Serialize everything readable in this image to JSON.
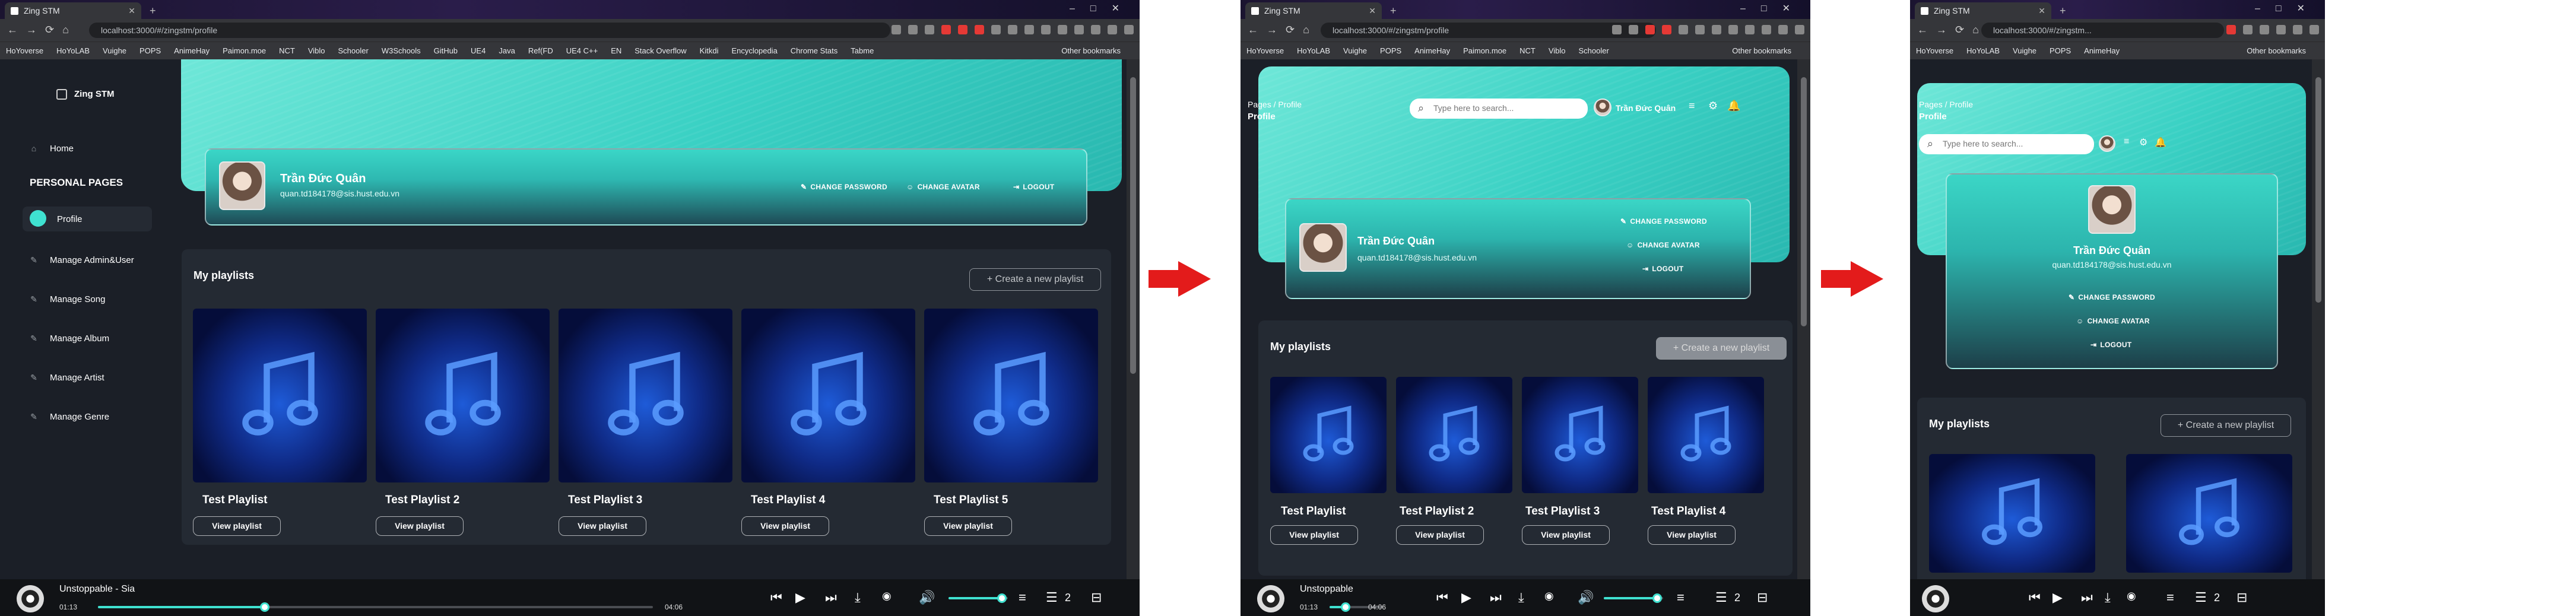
{
  "browser": {
    "tab_title": "Zing STM",
    "url_full": "localhost:3000/#/zingstm/profile",
    "url_mid": "localhost:3000/#/zingstm/profile",
    "url_short": "localhost:3000/#/zingstm...",
    "bookmarks": [
      "HoYoverse",
      "HoYoLAB",
      "Vuighe",
      "POPS",
      "AnimeHay",
      "Paimon.moe",
      "NCT",
      "Viblo",
      "Schooler",
      "W3Schools",
      "GitHub",
      "UE4",
      "Java",
      "Ref(FD",
      "UE4 C++",
      "EN",
      "Stack Overflow",
      "Kitkdi",
      "Encyclopedia",
      "Chrome Stats",
      "Tabme"
    ],
    "other_bookmarks": "Other bookmarks"
  },
  "sidebar": {
    "brand": "Zing STM",
    "home": "Home",
    "section": "PERSONAL PAGES",
    "items": [
      "Profile",
      "Manage Admin&User",
      "Manage Song",
      "Manage Album",
      "Manage Artist",
      "Manage Genre"
    ]
  },
  "header": {
    "breadcrumb_root": "Pages",
    "breadcrumb_sep": "/",
    "breadcrumb_page": "Profile",
    "page_title": "Profile",
    "search_placeholder": "Type here to search...",
    "user_short": "Trần Đức Quân"
  },
  "profile": {
    "name": "Trần Đức Quân",
    "email": "quan.td184178@sis.hust.edu.vn",
    "change_password": "CHANGE PASSWORD",
    "change_avatar": "CHANGE AVATAR",
    "logout": "LOGOUT"
  },
  "playlists": {
    "title": "My playlists",
    "create_label": "+ Create a new playlist",
    "view_label": "View playlist",
    "items": [
      "Test Playlist",
      "Test Playlist 2",
      "Test Playlist 3",
      "Test Playlist 4",
      "Test Playlist 5"
    ]
  },
  "player": {
    "track": "Unstoppable - Sia",
    "track_short": "Unstoppable",
    "current": "01:13",
    "duration": "04:06",
    "queue_count": "2",
    "progress_fraction": 0.3,
    "volume_fraction": 0.9
  },
  "colors": {
    "accent": "#3fe1d0",
    "arrow": "#e31b1b"
  }
}
